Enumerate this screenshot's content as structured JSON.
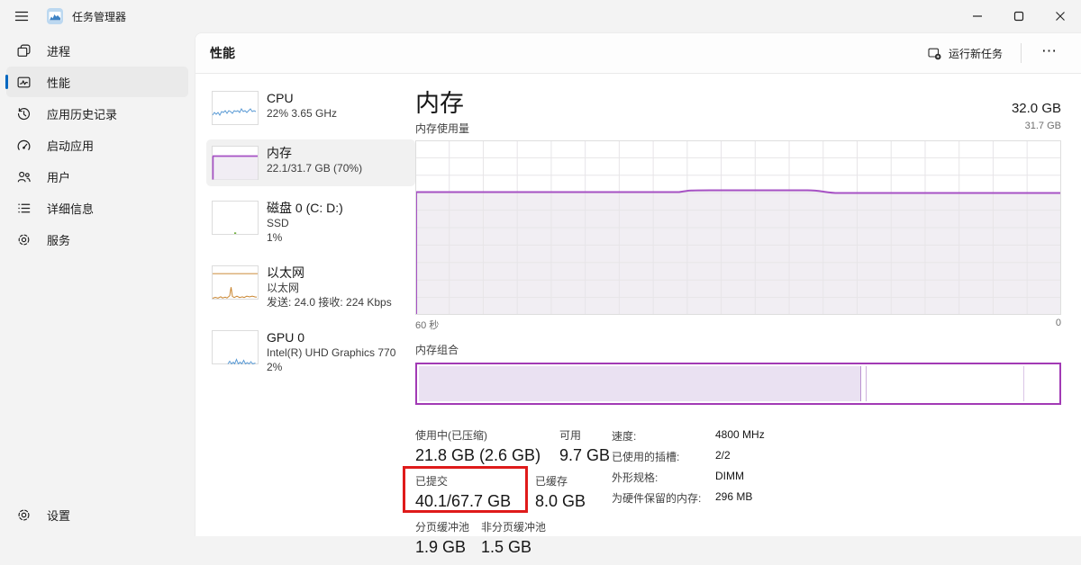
{
  "titlebar": {
    "app_title": "任务管理器"
  },
  "sidebar": {
    "items": [
      {
        "label": "进程"
      },
      {
        "label": "性能"
      },
      {
        "label": "应用历史记录"
      },
      {
        "label": "启动应用"
      },
      {
        "label": "用户"
      },
      {
        "label": "详细信息"
      },
      {
        "label": "服务"
      }
    ],
    "settings_label": "设置"
  },
  "header": {
    "tab_label": "性能",
    "run_new_task": "运行新任务",
    "more": "⋯"
  },
  "devices": [
    {
      "name": "CPU",
      "line1": "22% 3.65 GHz"
    },
    {
      "name": "内存",
      "line1": "22.1/31.7 GB (70%)"
    },
    {
      "name": "磁盘 0 (C: D:)",
      "line1": "SSD",
      "line2": "1%"
    },
    {
      "name": "以太网",
      "line1": "以太网",
      "line2": "发送: 24.0 接收: 224 Kbps"
    },
    {
      "name": "GPU 0",
      "line1": "Intel(R) UHD Graphics 770",
      "line2": "2%"
    }
  ],
  "memory": {
    "title": "内存",
    "total": "32.0 GB",
    "usage_label": "内存使用量",
    "axis_top": "31.7 GB",
    "axis_left": "60 秒",
    "axis_right": "0",
    "composition_label": "内存组合",
    "stats": {
      "in_use_label": "使用中(已压缩)",
      "in_use_value": "21.8 GB (2.6 GB)",
      "available_label": "可用",
      "available_value": "9.7 GB",
      "committed_label": "已提交",
      "committed_value": "40.1/67.7 GB",
      "cached_label": "已缓存",
      "cached_value": "8.0 GB",
      "paged_label": "分页缓冲池",
      "paged_value": "1.9 GB",
      "nonpaged_label": "非分页缓冲池",
      "nonpaged_value": "1.5 GB"
    },
    "details": [
      {
        "label": "速度:",
        "value": "4800 MHz"
      },
      {
        "label": "已使用的插槽:",
        "value": "2/2"
      },
      {
        "label": "外形规格:",
        "value": "DIMM"
      },
      {
        "label": "为硬件保留的内存:",
        "value": "296 MB"
      }
    ]
  },
  "chart_data": {
    "type": "area",
    "title": "内存使用量 (60 秒窗口)",
    "x_range_labels": [
      "60 秒",
      "0"
    ],
    "y_max_label": "31.7 GB",
    "usage_percent_series_note": "steady line at ~70% with slight bump mid-chart",
    "usage_percent": 70,
    "used_gb": 22.1,
    "capacity_gb": 31.7,
    "composition_segments": [
      {
        "name": "in-use",
        "percent": 69
      },
      {
        "name": "modified",
        "percent": 1
      },
      {
        "name": "standby",
        "percent": 24.5
      },
      {
        "name": "free",
        "percent": 5.5
      }
    ]
  },
  "colors": {
    "accent_blue": "#0067c0",
    "memory_purple": "#a651c4",
    "annotation_red": "#df1b1b",
    "cpu_blue": "#5b9bd5",
    "ethernet_orange": "#d0984f",
    "disk_green": "#74b244"
  }
}
